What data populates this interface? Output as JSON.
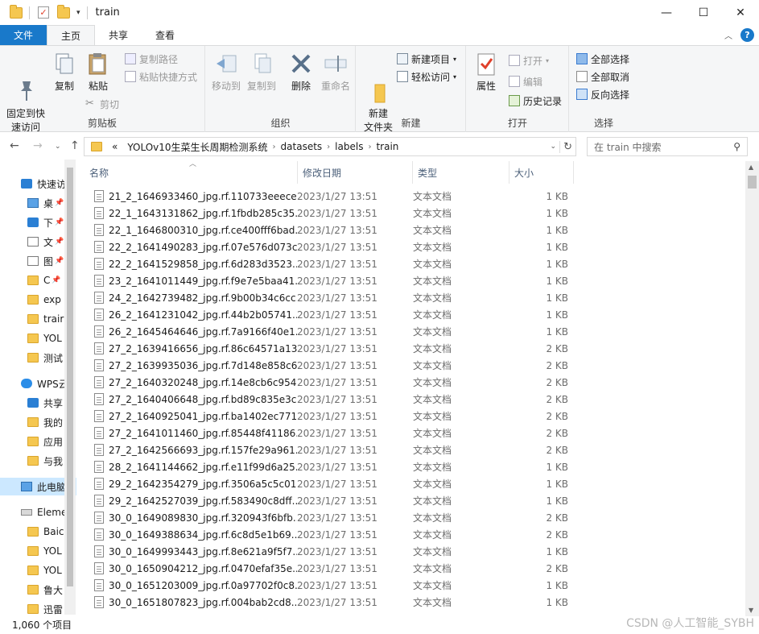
{
  "window": {
    "title": "train"
  },
  "ribbon_tabs": [
    {
      "label": "文件"
    },
    {
      "label": "主页"
    },
    {
      "label": "共享"
    },
    {
      "label": "查看"
    }
  ],
  "ribbon": {
    "clipboard": {
      "label": "剪贴板",
      "pin": "固定到快\n速访问",
      "copy": "复制",
      "paste": "粘贴",
      "copy_path": "复制路径",
      "paste_shortcut": "粘贴快捷方式",
      "cut": "剪切"
    },
    "organize": {
      "label": "组织",
      "move_to": "移动到",
      "copy_to": "复制到",
      "delete": "删除",
      "rename": "重命名"
    },
    "new": {
      "label": "新建",
      "new_folder": "新建\n文件夹",
      "new_item": "新建项目",
      "easy_access": "轻松访问"
    },
    "open": {
      "label": "打开",
      "properties": "属性",
      "open": "打开",
      "edit": "编辑",
      "history": "历史记录"
    },
    "select": {
      "label": "选择",
      "select_all": "全部选择",
      "select_none": "全部取消",
      "invert": "反向选择"
    }
  },
  "address": {
    "overflow": "«",
    "crumbs": [
      "YOLOv10生菜生长周期检测系统",
      "datasets",
      "labels",
      "train"
    ]
  },
  "search": {
    "placeholder": "在 train 中搜索"
  },
  "nav": [
    {
      "label": "快速访",
      "icon": "star-icon",
      "kind": "blue"
    },
    {
      "label": "桌",
      "icon": "desktop-icon",
      "kind": "pc",
      "pin": true
    },
    {
      "label": "下",
      "icon": "download-icon",
      "kind": "blue",
      "pin": true
    },
    {
      "label": "文",
      "icon": "document-icon",
      "kind": "doc",
      "pin": true
    },
    {
      "label": "图",
      "icon": "picture-icon",
      "kind": "doc",
      "pin": true
    },
    {
      "label": "C",
      "icon": "folder-icon",
      "kind": "folder",
      "pin": true
    },
    {
      "label": "exp",
      "icon": "folder-icon",
      "kind": "folder"
    },
    {
      "label": "trair",
      "icon": "folder-icon",
      "kind": "folder"
    },
    {
      "label": "YOL",
      "icon": "folder-icon",
      "kind": "folder"
    },
    {
      "label": "测试",
      "icon": "folder-icon",
      "kind": "folder"
    },
    {
      "label": "WPS云",
      "icon": "cloud-icon",
      "kind": "cloud"
    },
    {
      "label": "共享",
      "icon": "share-icon",
      "kind": "blue"
    },
    {
      "label": "我的",
      "icon": "folder-icon",
      "kind": "folder"
    },
    {
      "label": "应用",
      "icon": "folder-icon",
      "kind": "folder"
    },
    {
      "label": "与我",
      "icon": "folder-icon",
      "kind": "folder"
    },
    {
      "label": "此电脑",
      "icon": "computer-icon",
      "kind": "pc",
      "selected": true
    },
    {
      "label": "Eleme",
      "icon": "drive-icon",
      "kind": "drive"
    },
    {
      "label": "Baic",
      "icon": "folder-icon",
      "kind": "folder"
    },
    {
      "label": "YOL",
      "icon": "folder-icon",
      "kind": "folder"
    },
    {
      "label": "YOL",
      "icon": "folder-icon",
      "kind": "folder"
    },
    {
      "label": "鲁大",
      "icon": "folder-icon",
      "kind": "folder"
    },
    {
      "label": "迅雷",
      "icon": "folder-icon",
      "kind": "folder"
    }
  ],
  "columns": {
    "name": "名称",
    "date": "修改日期",
    "type": "类型",
    "size": "大小"
  },
  "files": [
    {
      "name": "21_2_1646933460_jpg.rf.110733eeece...",
      "date": "2023/1/27 13:51",
      "type": "文本文档",
      "size": "1 KB"
    },
    {
      "name": "22_1_1643131862_jpg.rf.1fbdb285c35...",
      "date": "2023/1/27 13:51",
      "type": "文本文档",
      "size": "1 KB"
    },
    {
      "name": "22_1_1646800310_jpg.rf.ce400fff6bad...",
      "date": "2023/1/27 13:51",
      "type": "文本文档",
      "size": "1 KB"
    },
    {
      "name": "22_2_1641490283_jpg.rf.07e576d073c...",
      "date": "2023/1/27 13:51",
      "type": "文本文档",
      "size": "1 KB"
    },
    {
      "name": "22_2_1641529858_jpg.rf.6d283d3523...",
      "date": "2023/1/27 13:51",
      "type": "文本文档",
      "size": "1 KB"
    },
    {
      "name": "23_2_1641011449_jpg.rf.f9e7e5baa41...",
      "date": "2023/1/27 13:51",
      "type": "文本文档",
      "size": "1 KB"
    },
    {
      "name": "24_2_1642739482_jpg.rf.9b00b34c6cc...",
      "date": "2023/1/27 13:51",
      "type": "文本文档",
      "size": "1 KB"
    },
    {
      "name": "26_2_1641231042_jpg.rf.44b2b05741...",
      "date": "2023/1/27 13:51",
      "type": "文本文档",
      "size": "1 KB"
    },
    {
      "name": "26_2_1645464646_jpg.rf.7a9166f40e1...",
      "date": "2023/1/27 13:51",
      "type": "文本文档",
      "size": "1 KB"
    },
    {
      "name": "27_2_1639416656_jpg.rf.86c64571a13...",
      "date": "2023/1/27 13:51",
      "type": "文本文档",
      "size": "2 KB"
    },
    {
      "name": "27_2_1639935036_jpg.rf.7d148e858c6...",
      "date": "2023/1/27 13:51",
      "type": "文本文档",
      "size": "2 KB"
    },
    {
      "name": "27_2_1640320248_jpg.rf.14e8cb6c954...",
      "date": "2023/1/27 13:51",
      "type": "文本文档",
      "size": "2 KB"
    },
    {
      "name": "27_2_1640406648_jpg.rf.bd89c835e3c...",
      "date": "2023/1/27 13:51",
      "type": "文本文档",
      "size": "2 KB"
    },
    {
      "name": "27_2_1640925041_jpg.rf.ba1402ec771...",
      "date": "2023/1/27 13:51",
      "type": "文本文档",
      "size": "2 KB"
    },
    {
      "name": "27_2_1641011460_jpg.rf.85448f41186...",
      "date": "2023/1/27 13:51",
      "type": "文本文档",
      "size": "2 KB"
    },
    {
      "name": "27_2_1642566693_jpg.rf.157fe29a961...",
      "date": "2023/1/27 13:51",
      "type": "文本文档",
      "size": "2 KB"
    },
    {
      "name": "28_2_1641144662_jpg.rf.e11f99d6a25...",
      "date": "2023/1/27 13:51",
      "type": "文本文档",
      "size": "1 KB"
    },
    {
      "name": "29_2_1642354279_jpg.rf.3506a5c5c01...",
      "date": "2023/1/27 13:51",
      "type": "文本文档",
      "size": "1 KB"
    },
    {
      "name": "29_2_1642527039_jpg.rf.583490c8dff...",
      "date": "2023/1/27 13:51",
      "type": "文本文档",
      "size": "1 KB"
    },
    {
      "name": "30_0_1649089830_jpg.rf.320943f6bfb...",
      "date": "2023/1/27 13:51",
      "type": "文本文档",
      "size": "2 KB"
    },
    {
      "name": "30_0_1649388634_jpg.rf.6c8d5e1b69...",
      "date": "2023/1/27 13:51",
      "type": "文本文档",
      "size": "2 KB"
    },
    {
      "name": "30_0_1649993443_jpg.rf.8e621a9f5f7...",
      "date": "2023/1/27 13:51",
      "type": "文本文档",
      "size": "1 KB"
    },
    {
      "name": "30_0_1650904212_jpg.rf.0470efaf35e...",
      "date": "2023/1/27 13:51",
      "type": "文本文档",
      "size": "2 KB"
    },
    {
      "name": "30_0_1651203009_jpg.rf.0a97702f0c8...",
      "date": "2023/1/27 13:51",
      "type": "文本文档",
      "size": "1 KB"
    },
    {
      "name": "30_0_1651807823_jpg.rf.004bab2cd8...",
      "date": "2023/1/27 13:51",
      "type": "文本文档",
      "size": "1 KB"
    }
  ],
  "status": {
    "count": "1,060 个项目"
  },
  "watermark": "CSDN @人工智能_SYBH",
  "colors": {
    "accent": "#1979ca",
    "selection": "#cce8ff",
    "folder": "#f5c750"
  }
}
